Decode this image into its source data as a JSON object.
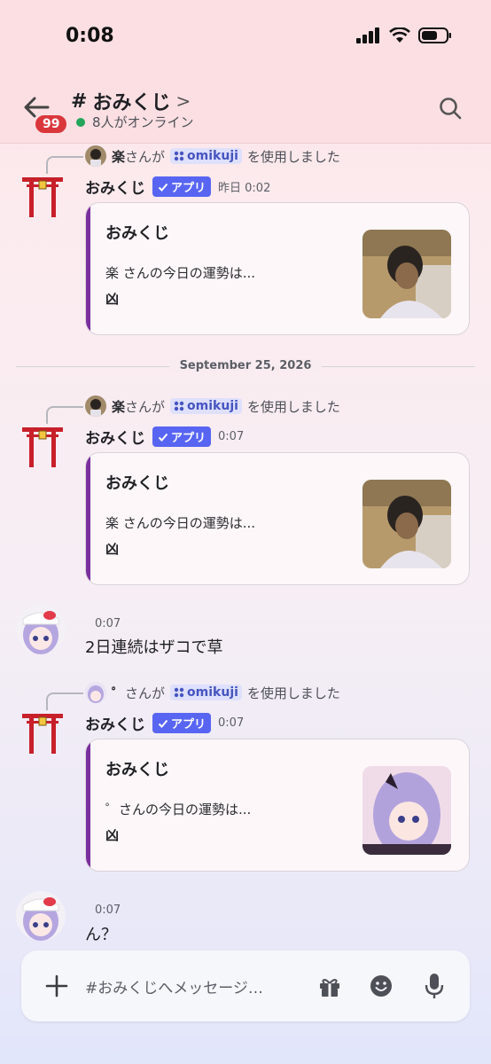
{
  "status_bar": {
    "time": "0:08"
  },
  "header": {
    "channel_hash": "#",
    "channel_name": "おみくじ",
    "chevron": ">",
    "unread_badge": "99",
    "online_text": "8人がオンライン"
  },
  "messages": [
    {
      "reply_user": "楽",
      "reply_text_mid": "さんが",
      "command": "omikuji",
      "reply_text_end": "を使用しました",
      "author": "おみくじ",
      "app_label": "アプリ",
      "timestamp": "昨日 0:02",
      "embed_title": "おみくじ",
      "embed_desc": "楽 さんの今日の運勢は...",
      "embed_fortune": "凶"
    },
    {
      "reply_user": "楽",
      "reply_text_mid": "さんが",
      "command": "omikuji",
      "reply_text_end": "を使用しました",
      "author": "おみくじ",
      "app_label": "アプリ",
      "timestamp": "0:07",
      "embed_title": "おみくじ",
      "embed_desc": "楽 さんの今日の運勢は...",
      "embed_fortune": "凶"
    },
    {
      "reply_user": "゜",
      "reply_text_mid": "さんが",
      "command": "omikuji",
      "reply_text_end": "を使用しました",
      "author": "おみくじ",
      "app_label": "アプリ",
      "timestamp": "0:07",
      "embed_title": "おみくじ",
      "embed_desc": "゜さんの今日の運勢は...",
      "embed_fortune": "凶"
    }
  ],
  "date_divider": "September 25, 2026",
  "user_messages": [
    {
      "timestamp": "0:07",
      "text": "2日連続はザコで草"
    },
    {
      "timestamp": "0:07",
      "text": "ん？"
    }
  ],
  "composer": {
    "placeholder": "#おみくじへメッセージ…"
  },
  "colors": {
    "header_bg": "#fbdfe2",
    "badge": "#da373c",
    "online": "#23a55a",
    "app_tag": "#5865f2",
    "embed_bar": "#7a2f9e",
    "torii": "#c8202a"
  }
}
